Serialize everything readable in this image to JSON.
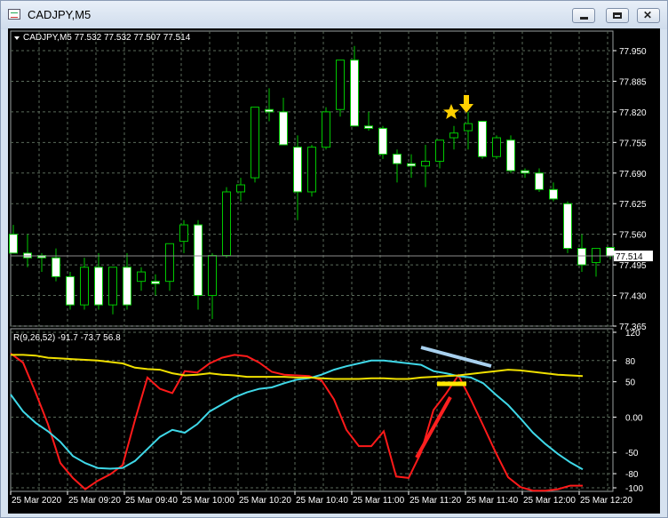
{
  "window": {
    "title": "CADJPY,M5"
  },
  "price_panel": {
    "header": "CADJPY,M5  77.532 77.532 77.507 77.514",
    "current_price": "77.514",
    "y_ticks": [
      "77.950",
      "77.885",
      "77.820",
      "77.755",
      "77.690",
      "77.625",
      "77.560",
      "77.495",
      "77.430",
      "77.365"
    ]
  },
  "indicator_panel": {
    "header": "R(9,26,52) -91.7 -73.7 56.8",
    "y_ticks": [
      "120",
      "80",
      "50",
      "0.00",
      "-50",
      "-80",
      "-100"
    ]
  },
  "x_labels": [
    "25 Mar 2020",
    "25 Mar 09:20",
    "25 Mar 09:40",
    "25 Mar 10:00",
    "25 Mar 10:20",
    "25 Mar 10:40",
    "25 Mar 11:00",
    "25 Mar 11:20",
    "25 Mar 11:40",
    "25 Mar 12:00",
    "25 Mar 12:20"
  ],
  "colors": {
    "background": "#000000",
    "grid": "#5a6a5a",
    "bull": "#00c800",
    "bear_body": "#ffffff",
    "fast_line": "#ff1a1a",
    "mid_line": "#3fd8e8",
    "slow_line": "#f0e000",
    "annotation_red": "#ff2020",
    "annotation_blue": "#a8d0ee",
    "annotation_yellow": "#ffe800",
    "marker": "#ffd000"
  },
  "icons": [
    "chart-window-icon",
    "dropdown-triangle-icon",
    "minimize-icon",
    "maximize-icon",
    "close-icon",
    "star-marker-icon",
    "down-arrow-marker-icon"
  ],
  "chart_data": [
    {
      "type": "candlestick",
      "symbol": "CADJPY",
      "timeframe": "M5",
      "title": "CADJPY,M5",
      "ylim": [
        77.365,
        77.95
      ],
      "candles": [
        {
          "o": 77.56,
          "h": 77.58,
          "l": 77.52,
          "c": 77.52
        },
        {
          "o": 77.52,
          "h": 77.56,
          "l": 77.49,
          "c": 77.51
        },
        {
          "o": 77.515,
          "h": 77.52,
          "l": 77.48,
          "c": 77.51
        },
        {
          "o": 77.51,
          "h": 77.53,
          "l": 77.46,
          "c": 77.47
        },
        {
          "o": 77.47,
          "h": 77.48,
          "l": 77.4,
          "c": 77.41
        },
        {
          "o": 77.41,
          "h": 77.51,
          "l": 77.4,
          "c": 77.49
        },
        {
          "o": 77.49,
          "h": 77.52,
          "l": 77.4,
          "c": 77.41
        },
        {
          "o": 77.41,
          "h": 77.49,
          "l": 77.39,
          "c": 77.49
        },
        {
          "o": 77.49,
          "h": 77.52,
          "l": 77.4,
          "c": 77.41
        },
        {
          "o": 77.46,
          "h": 77.49,
          "l": 77.44,
          "c": 77.48
        },
        {
          "o": 77.46,
          "h": 77.475,
          "l": 77.43,
          "c": 77.455
        },
        {
          "o": 77.46,
          "h": 77.54,
          "l": 77.44,
          "c": 77.54
        },
        {
          "o": 77.545,
          "h": 77.59,
          "l": 77.52,
          "c": 77.58
        },
        {
          "o": 77.58,
          "h": 77.59,
          "l": 77.4,
          "c": 77.43
        },
        {
          "o": 77.43,
          "h": 77.52,
          "l": 77.38,
          "c": 77.515
        },
        {
          "o": 77.515,
          "h": 77.66,
          "l": 77.51,
          "c": 77.65
        },
        {
          "o": 77.65,
          "h": 77.68,
          "l": 77.63,
          "c": 77.665
        },
        {
          "o": 77.68,
          "h": 77.83,
          "l": 77.67,
          "c": 77.83
        },
        {
          "o": 77.825,
          "h": 77.87,
          "l": 77.8,
          "c": 77.82
        },
        {
          "o": 77.82,
          "h": 77.85,
          "l": 77.75,
          "c": 77.75
        },
        {
          "o": 77.745,
          "h": 77.77,
          "l": 77.59,
          "c": 77.65
        },
        {
          "o": 77.65,
          "h": 77.75,
          "l": 77.64,
          "c": 77.745
        },
        {
          "o": 77.745,
          "h": 77.83,
          "l": 77.74,
          "c": 77.82
        },
        {
          "o": 77.825,
          "h": 77.93,
          "l": 77.81,
          "c": 77.93
        },
        {
          "o": 77.93,
          "h": 77.96,
          "l": 77.79,
          "c": 77.79
        },
        {
          "o": 77.79,
          "h": 77.82,
          "l": 77.78,
          "c": 77.785
        },
        {
          "o": 77.785,
          "h": 77.79,
          "l": 77.72,
          "c": 77.73
        },
        {
          "o": 77.73,
          "h": 77.74,
          "l": 77.67,
          "c": 77.71
        },
        {
          "o": 77.71,
          "h": 77.73,
          "l": 77.68,
          "c": 77.705
        },
        {
          "o": 77.705,
          "h": 77.75,
          "l": 77.66,
          "c": 77.715
        },
        {
          "o": 77.715,
          "h": 77.76,
          "l": 77.7,
          "c": 77.76
        },
        {
          "o": 77.765,
          "h": 77.79,
          "l": 77.74,
          "c": 77.775
        },
        {
          "o": 77.78,
          "h": 77.82,
          "l": 77.74,
          "c": 77.795
        },
        {
          "o": 77.8,
          "h": 77.8,
          "l": 77.72,
          "c": 77.725
        },
        {
          "o": 77.725,
          "h": 77.77,
          "l": 77.72,
          "c": 77.765
        },
        {
          "o": 77.76,
          "h": 77.77,
          "l": 77.69,
          "c": 77.695
        },
        {
          "o": 77.695,
          "h": 77.7,
          "l": 77.68,
          "c": 77.69
        },
        {
          "o": 77.69,
          "h": 77.7,
          "l": 77.65,
          "c": 77.655
        },
        {
          "o": 77.655,
          "h": 77.67,
          "l": 77.63,
          "c": 77.635
        },
        {
          "o": 77.625,
          "h": 77.63,
          "l": 77.52,
          "c": 77.53
        },
        {
          "o": 77.53,
          "h": 77.56,
          "l": 77.48,
          "c": 77.495
        },
        {
          "o": 77.5,
          "h": 77.53,
          "l": 77.47,
          "c": 77.53
        },
        {
          "o": 77.532,
          "h": 77.532,
          "l": 77.507,
          "c": 77.514
        }
      ],
      "current_price": 77.514
    },
    {
      "type": "line",
      "title": "R(9,26,52) -91.7 -73.7 56.8",
      "ylim": [
        -105,
        125
      ],
      "series": [
        {
          "name": "9",
          "values": [
            90,
            77,
            35,
            -10,
            -65,
            -86,
            -102,
            -90,
            -81,
            -68,
            -4,
            56,
            40,
            34,
            65,
            63,
            76,
            84,
            88,
            86,
            77,
            64,
            60,
            59,
            58,
            52,
            25,
            -18,
            -41,
            -41,
            -20,
            -84,
            -86,
            -50,
            10,
            33,
            59,
            25,
            -12,
            -50,
            -85,
            -99,
            -104,
            -104,
            -102,
            -97,
            -97
          ]
        },
        {
          "name": "26",
          "values": [
            32,
            8,
            -8,
            -20,
            -35,
            -55,
            -65,
            -72,
            -73,
            -72,
            -62,
            -45,
            -28,
            -18,
            -22,
            -10,
            8,
            18,
            28,
            35,
            40,
            42,
            48,
            53,
            55,
            60,
            67,
            72,
            76,
            80,
            80,
            78,
            76,
            74,
            65,
            62,
            58,
            56,
            48,
            32,
            17,
            -2,
            -22,
            -38,
            -52,
            -64,
            -74
          ]
        },
        {
          "name": "52",
          "values": [
            88,
            88,
            87,
            84,
            83,
            82,
            81,
            80,
            78,
            76,
            70,
            68,
            67,
            62,
            59,
            60,
            62,
            60,
            59,
            57,
            57,
            57,
            57,
            56,
            56,
            55,
            54,
            54,
            54,
            55,
            55,
            54,
            54,
            56,
            57,
            58,
            59,
            61,
            63,
            65,
            67,
            66,
            64,
            62,
            60,
            59,
            58
          ]
        }
      ]
    }
  ]
}
